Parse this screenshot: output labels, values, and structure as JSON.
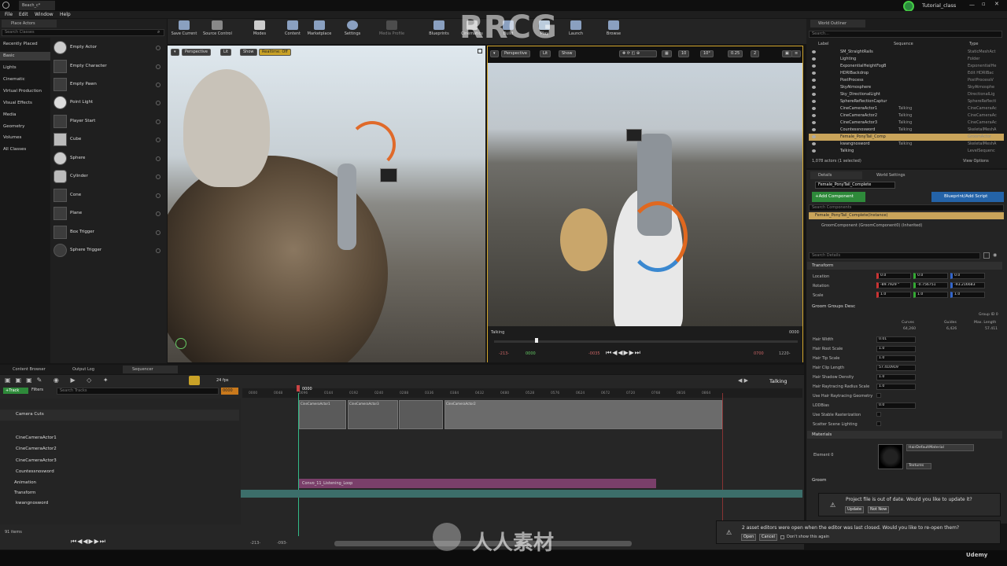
{
  "window": {
    "title": "Tutorial_class",
    "doc_tab": "Beach_c*"
  },
  "menu": [
    "File",
    "Edit",
    "Window",
    "Help"
  ],
  "place_actors": {
    "tab": "Place Actors",
    "search_placeholder": "Search Classes",
    "categories": [
      "Recently Placed",
      "Basic",
      "Lights",
      "Cinematic",
      "Virtual Production",
      "Visual Effects",
      "Media",
      "Geometry",
      "Volumes",
      "All Classes"
    ],
    "items": [
      "Empty Actor",
      "Empty Character",
      "Empty Pawn",
      "Point Light",
      "Player Start",
      "Cube",
      "Sphere",
      "Cylinder",
      "Cone",
      "Plane",
      "Box Trigger",
      "Sphere Trigger"
    ]
  },
  "toolbar": [
    "Save Current",
    "Source Control",
    "Modes",
    "Content",
    "Marketplace",
    "Settings",
    "Media Profile",
    "Blueprints",
    "Cinematics",
    "Build",
    "Play",
    "Launch",
    "Browse"
  ],
  "viewport_left": {
    "perspective": "Perspective",
    "lit": "Lit",
    "show": "Show",
    "realtime": "Realtime: Off"
  },
  "viewport_right": {
    "perspective": "Perspective",
    "lit": "Lit",
    "show": "Show",
    "snap_angle": "10°",
    "cam_speed": "0.25",
    "layers": "2",
    "grid": "10",
    "timeline_label": "Talking",
    "timeline_end": "0000",
    "playback": {
      "left_a": "-213-",
      "left_b": "0000",
      "mid": "-0035",
      "right_a": "0700",
      "right_b": "1220-"
    }
  },
  "outliner": {
    "tab": "World Outliner",
    "search_placeholder": "Search...",
    "cols": [
      "Label",
      "Sequence",
      "Type"
    ],
    "rows": [
      {
        "name": "SM_StraightRails",
        "seq": "",
        "type": "StaticMeshAct"
      },
      {
        "name": "Lighting",
        "seq": "",
        "type": "Folder"
      },
      {
        "name": "ExponentialHeightFogB",
        "seq": "",
        "type": "ExponentialHe"
      },
      {
        "name": "HDRIBackdrop",
        "seq": "",
        "type": "Edit HDRIBac"
      },
      {
        "name": "PostProcess",
        "seq": "",
        "type": "PostProcessV"
      },
      {
        "name": "SkyAtmosphere",
        "seq": "",
        "type": "SkyAtmosphe"
      },
      {
        "name": "Sky_DirectionalLight",
        "seq": "",
        "type": "DirectionalLig"
      },
      {
        "name": "SphereReflectionCaptur",
        "seq": "",
        "type": "SphereReflecti"
      },
      {
        "name": "CineCameraActor1",
        "seq": "Talking",
        "type": "CineCameraAc"
      },
      {
        "name": "CineCameraActor2",
        "seq": "Talking",
        "type": "CineCameraAc"
      },
      {
        "name": "CineCameraActor3",
        "seq": "Talking",
        "type": "CineCameraAc"
      },
      {
        "name": "Countessnosword",
        "seq": "Talking",
        "type": "SkeletalMeshA"
      },
      {
        "name": "Female_PonyTail_Comp",
        "seq": "",
        "type": "GroomActor"
      },
      {
        "name": "kwangnosword",
        "seq": "Talking",
        "type": "SkeletalMeshA"
      },
      {
        "name": "Talking",
        "seq": "",
        "type": "LevelSequenc"
      }
    ],
    "count": "1,078 actors (1 selected)",
    "view_options": "View Options"
  },
  "details": {
    "tab": "Details",
    "tab2": "World Settings",
    "actor_name": "Female_PonyTail_Complete",
    "add_component": "+Add Component",
    "blueprint": "Blueprint/Add Script",
    "search_components": "Search Components",
    "comp_instance": "Female_PonyTail_Complete(Instance)",
    "comp_groom": "GroomComponent (GroomComponent0) (Inherited)",
    "search_details": "Search Details",
    "transform_header": "Transform",
    "location": {
      "label": "Location",
      "x": "0.0",
      "y": "0.0",
      "z": "0.0"
    },
    "rotation": {
      "label": "Rotation",
      "x": "-89.7929 °",
      "y": "-0.756751",
      "z": "-93.216683"
    },
    "scale": {
      "label": "Scale",
      "x": "1.0",
      "y": "1.0",
      "z": "1.0"
    },
    "groom_groups": "Groom Groups Desc",
    "group_id": "Group ID 0",
    "stats": {
      "curves": "Curves",
      "curves_v": "64,260",
      "guides": "Guides",
      "guides_v": "6,426",
      "maxlen": "Max. Length",
      "maxlen_v": "57.411"
    },
    "props": [
      {
        "label": "Hair Width",
        "value": "0.01"
      },
      {
        "label": "Hair Root Scale",
        "value": "1.0"
      },
      {
        "label": "Hair Tip Scale",
        "value": "1.0"
      },
      {
        "label": "Hair Clip Length",
        "value": "57.410919"
      },
      {
        "label": "Hair Shadow Density",
        "value": "1.0"
      },
      {
        "label": "Hair Raytracing Radius Scale",
        "value": "1.0"
      },
      {
        "label": "Use Hair Raytracing Geometry",
        "value": ""
      },
      {
        "label": "LODBias",
        "value": "0.0"
      },
      {
        "label": "Use Stable Rasterization",
        "value": ""
      },
      {
        "label": "Scatter Scene Lighting",
        "value": ""
      }
    ],
    "materials_header": "Materials",
    "element0": "Element 0",
    "material_name": "HairDefaultMaterial",
    "textures": "Textures",
    "groom_header": "Groom"
  },
  "bottom_tabs": [
    "Content Browser",
    "Output Log",
    "Sequencer"
  ],
  "sequencer": {
    "fps": "24 fps",
    "add_track": "+Track",
    "filters": "Filters",
    "search_placeholder": "Search Tracks",
    "sequence_name": "Talking",
    "current_frame": "0000",
    "ruler": [
      "0000",
      "0048",
      "0096",
      "0144",
      "0192",
      "0240",
      "0288",
      "0336",
      "0384",
      "0432",
      "0480",
      "0528",
      "0576",
      "0624",
      "0672",
      "0720",
      "0768",
      "0816",
      "0864"
    ],
    "tracks": [
      "Camera Cuts",
      "CineCameraActor1",
      "CineCameraActor2",
      "CineCameraActor3",
      "Countessnosword",
      "Animation",
      "Transform",
      "kwangnosword"
    ],
    "shots": [
      "CineCameraActor1",
      "CineCameraActor3",
      "CineCameraActor2"
    ],
    "anim_clip": "Convo_11_Listening_Loop",
    "items_count": "91 items",
    "range_start": "-213-",
    "range_in": "-093-",
    "range_end": "1220-"
  },
  "notifications": {
    "update_msg": "Project file is out of date. Would you like to update it?",
    "update_btn": "Update",
    "not_now_btn": "Not Now",
    "reopen_msg": "2 asset editors were open when the editor was last closed. Would you like to re-open them?",
    "open_btn": "Open",
    "cancel_btn": "Cancel",
    "dont_show": "Don't show this again"
  },
  "watermark": {
    "brand": "RRCG",
    "site": "人人素材",
    "udemy": "Udemy"
  }
}
